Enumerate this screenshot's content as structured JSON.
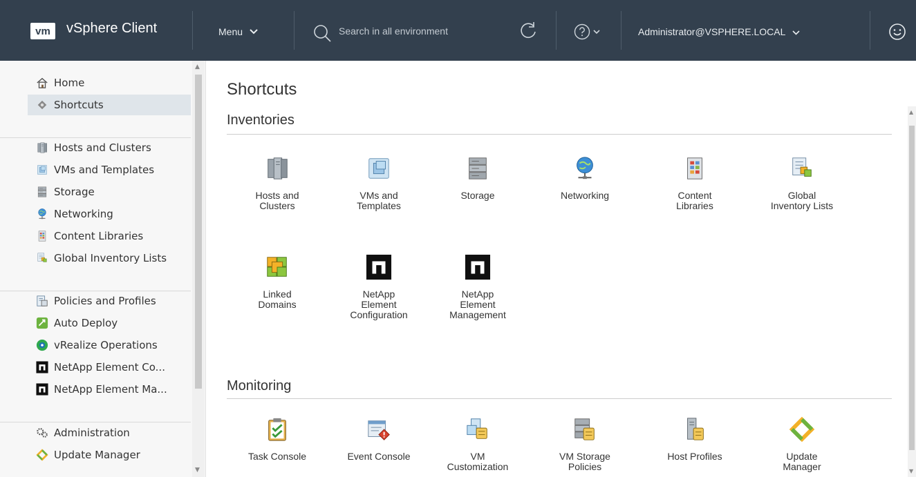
{
  "header": {
    "logo_text": "vm",
    "app_title": "vSphere Client",
    "menu_label": "Menu",
    "search_placeholder": "Search in all environment",
    "user_label": "Administrator@VSPHERE.LOCAL",
    "background_color": "#33404e"
  },
  "sidebar": {
    "groups": [
      [
        {
          "label": "Home",
          "icon": "home-icon"
        },
        {
          "label": "Shortcuts",
          "icon": "shortcuts-icon",
          "active": true
        }
      ],
      [
        {
          "label": "Hosts and Clusters",
          "icon": "hosts-clusters-icon"
        },
        {
          "label": "VMs and Templates",
          "icon": "vms-templates-icon"
        },
        {
          "label": "Storage",
          "icon": "storage-icon"
        },
        {
          "label": "Networking",
          "icon": "networking-icon"
        },
        {
          "label": "Content Libraries",
          "icon": "content-libraries-icon"
        },
        {
          "label": "Global Inventory Lists",
          "icon": "global-inventory-icon"
        }
      ],
      [
        {
          "label": "Policies and Profiles",
          "icon": "policies-profiles-icon"
        },
        {
          "label": "Auto Deploy",
          "icon": "auto-deploy-icon"
        },
        {
          "label": "vRealize Operations",
          "icon": "vrealize-icon"
        },
        {
          "label": "NetApp Element Co...",
          "icon": "netapp-icon"
        },
        {
          "label": "NetApp Element Ma...",
          "icon": "netapp-icon"
        }
      ],
      [
        {
          "label": "Administration",
          "icon": "administration-icon"
        },
        {
          "label": "Update Manager",
          "icon": "update-manager-icon"
        }
      ]
    ]
  },
  "main": {
    "title": "Shortcuts",
    "sections": [
      {
        "title": "Inventories",
        "tiles": [
          {
            "label": "Hosts and Clusters",
            "icon": "hosts-clusters-icon"
          },
          {
            "label": "VMs and Templates",
            "icon": "vms-templates-icon"
          },
          {
            "label": "Storage",
            "icon": "storage-icon"
          },
          {
            "label": "Networking",
            "icon": "networking-icon"
          },
          {
            "label": "Content Libraries",
            "icon": "content-libraries-icon"
          },
          {
            "label": "Global Inventory Lists",
            "icon": "global-inventory-icon"
          },
          {
            "label": "Linked Domains",
            "icon": "linked-domains-icon"
          },
          {
            "label": "NetApp Element Configuration",
            "icon": "netapp-icon"
          },
          {
            "label": "NetApp Element Management",
            "icon": "netapp-icon"
          }
        ]
      },
      {
        "title": "Monitoring",
        "tiles": [
          {
            "label": "Task Console",
            "icon": "task-console-icon"
          },
          {
            "label": "Event Console",
            "icon": "event-console-icon"
          },
          {
            "label": "VM Customization",
            "icon": "vm-customization-icon"
          },
          {
            "label": "VM Storage Policies",
            "icon": "vm-storage-policies-icon"
          },
          {
            "label": "Host Profiles",
            "icon": "host-profiles-icon"
          },
          {
            "label": "Update Manager",
            "icon": "update-manager-icon"
          }
        ]
      }
    ]
  }
}
